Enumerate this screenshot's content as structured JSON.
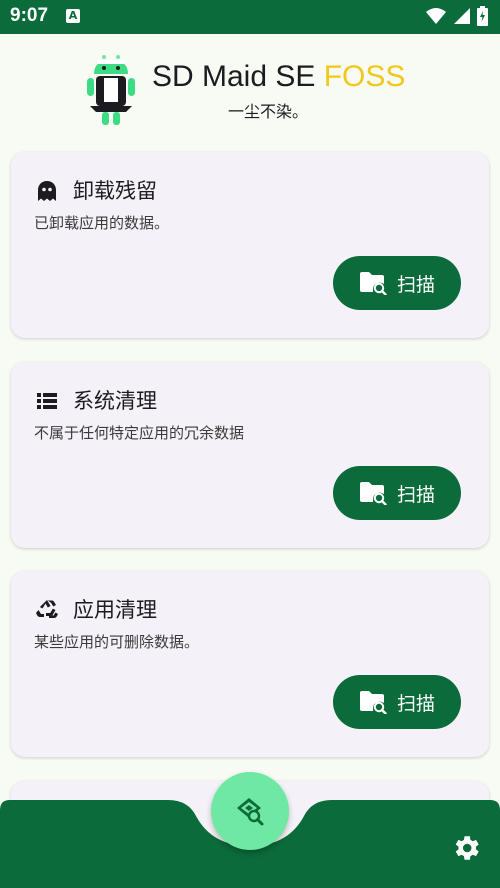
{
  "status_bar": {
    "time": "9:07",
    "notification_glyph": "A",
    "icons": [
      "wifi-icon",
      "signal-icon",
      "battery-icon"
    ]
  },
  "header": {
    "title_main": "SD Maid SE",
    "title_accent": "FOSS",
    "tagline": "一尘不染。"
  },
  "cards": [
    {
      "icon": "ghost-icon",
      "title": "卸载残留",
      "description": "已卸载应用的数据。",
      "button_label": "扫描"
    },
    {
      "icon": "list-icon",
      "title": "系统清理",
      "description": "不属于任何特定应用的冗余数据",
      "button_label": "扫描"
    },
    {
      "icon": "recycle-icon",
      "title": "应用清理",
      "description": "某些应用的可删除数据。",
      "button_label": "扫描"
    },
    {
      "icon": "document-icon",
      "title": "",
      "description": "",
      "button_label": ""
    }
  ],
  "bottom_bar": {
    "fab_icon": "broom-search-icon",
    "settings_icon": "gear-icon"
  },
  "colors": {
    "primary": "#0b6b3a",
    "accent_yellow": "#f2c81a",
    "fab": "#6ee8a2",
    "card_bg": "#f5f1f8",
    "page_bg": "#f8fbf3"
  }
}
